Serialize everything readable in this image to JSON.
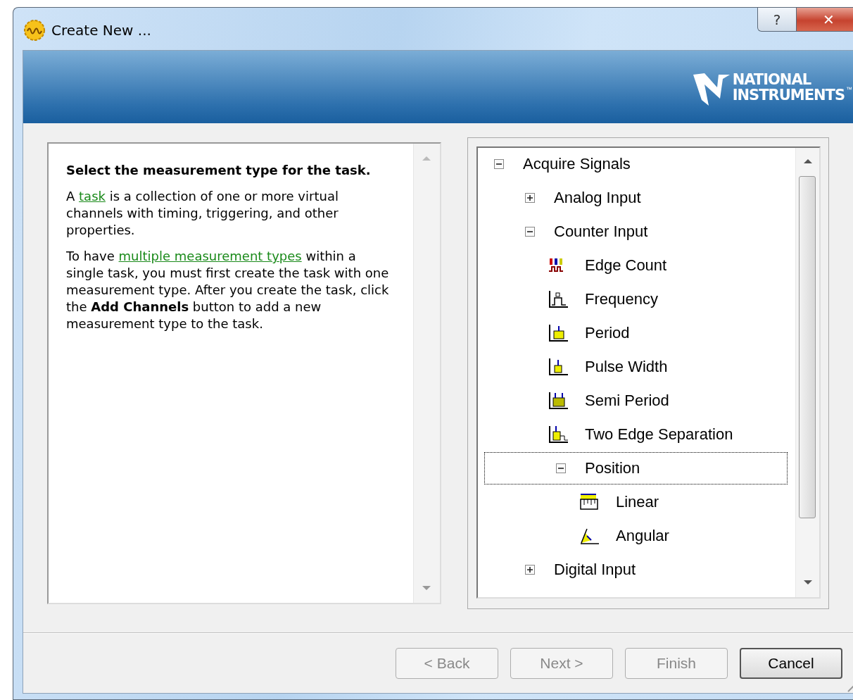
{
  "window": {
    "title": "Create New ...",
    "title_buttons": [
      {
        "kind": "help",
        "glyph": "?"
      },
      {
        "kind": "close",
        "glyph": "✕"
      }
    ]
  },
  "banner": {
    "logo_lines": [
      "NATIONAL",
      "INSTRUMENTS"
    ],
    "trademark": "™"
  },
  "help": {
    "heading": "Select the measurement type for the task.",
    "paragraphs": [
      {
        "parts": [
          {
            "kind": "text",
            "text": "A "
          },
          {
            "kind": "link",
            "text": "task"
          },
          {
            "kind": "text",
            "text": " is a collection of one or more virtual channels with timing, triggering, and other properties."
          }
        ]
      },
      {
        "parts": [
          {
            "kind": "text",
            "text": "To have "
          },
          {
            "kind": "link",
            "text": "multiple measurement types"
          },
          {
            "kind": "text",
            "text": " within a single task, you must first create the task with one measurement type. After you create the task, click the **Add Channels** button to add a new measurement type to the task."
          }
        ]
      }
    ]
  },
  "tree": [
    {
      "label": "Acquire Signals",
      "expanded": true,
      "selected": false,
      "children": [
        {
          "label": "Analog Input",
          "expanded": false,
          "selected": false
        },
        {
          "label": "Counter Input",
          "expanded": true,
          "selected": false,
          "children": [
            {
              "label": "Edge Count",
              "kind": "count",
              "selected": false
            },
            {
              "label": "Frequency",
              "kind": "frequency",
              "selected": false
            },
            {
              "label": "Period",
              "kind": "period",
              "selected": false
            },
            {
              "label": "Pulse Width",
              "kind": "pulse",
              "selected": false
            },
            {
              "label": "Semi Period",
              "kind": "semi",
              "selected": false
            },
            {
              "label": "Two Edge Separation",
              "kind": "twoedge",
              "selected": false
            },
            {
              "label": "Position",
              "expanded": true,
              "selected": true,
              "children": [
                {
                  "label": "Linear",
                  "kind": "linear",
                  "selected": false
                },
                {
                  "label": "Angular",
                  "kind": "angular",
                  "selected": false
                }
              ]
            }
          ]
        },
        {
          "label": "Digital Input",
          "expanded": false,
          "selected": false
        }
      ]
    }
  ],
  "buttons": [
    {
      "label": "< Back",
      "disabled": true,
      "default": false
    },
    {
      "label": "Next >",
      "disabled": true,
      "default": false
    },
    {
      "label": "Finish",
      "disabled": true,
      "default": false
    },
    {
      "label": "Cancel",
      "disabled": false,
      "default": true
    }
  ]
}
